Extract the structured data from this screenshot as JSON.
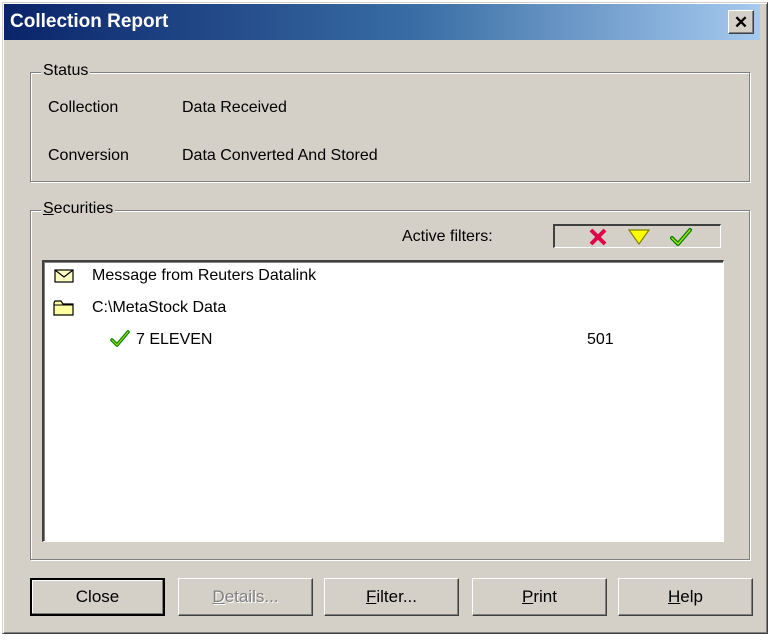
{
  "window": {
    "title": "Collection Report",
    "close_glyph": "✕"
  },
  "status": {
    "legend": "Status",
    "rows": [
      {
        "label": "Collection",
        "value": "Data Received"
      },
      {
        "label": "Conversion",
        "value": "Data Converted And Stored"
      }
    ]
  },
  "securities": {
    "legend_mnemonic": "S",
    "legend_rest": "ecurities",
    "active_filters_label": "Active filters:",
    "filter_icons": [
      "x-icon",
      "triangle-icon",
      "checkmark-icon"
    ],
    "items": [
      {
        "icon": "envelope-icon",
        "text": "Message from Reuters Datalink"
      },
      {
        "icon": "folder-icon",
        "text": "C:\\MetaStock Data"
      },
      {
        "icon": "checkmark-icon",
        "text": "7 ELEVEN",
        "value": "501"
      }
    ]
  },
  "buttons": {
    "close": "Close",
    "details_mnemonic": "D",
    "details_rest": "etails...",
    "filter_mnemonic": "F",
    "filter_rest": "ilter...",
    "print_mnemonic": "P",
    "print_rest": "rint",
    "help_mnemonic": "H",
    "help_rest": "elp"
  },
  "colors": {
    "title_start": "#0a246a",
    "title_end": "#a6caf0",
    "x_icon": "#e0004a",
    "triangle_icon": "#ffff00",
    "check_icon": "#008000",
    "envelope_fill": "#ffffc0",
    "folder_fill": "#ffffa0"
  }
}
